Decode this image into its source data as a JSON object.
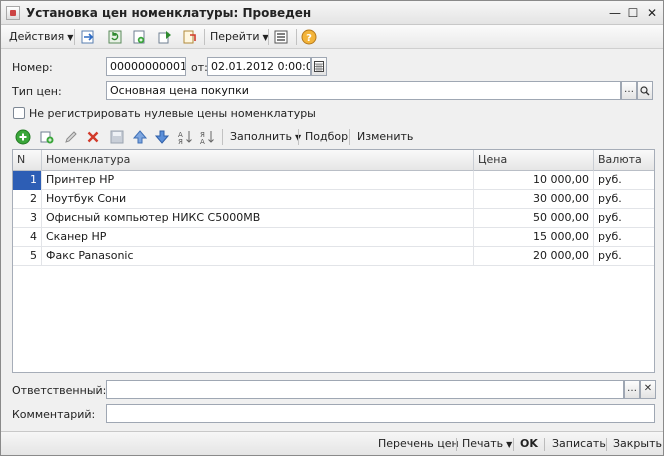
{
  "window": {
    "title": "Установка цен номенклатуры: Проведен",
    "controls": [
      "—",
      "☐",
      "✕"
    ]
  },
  "toolbar": {
    "actions_label": "Действия",
    "goto_label": "Перейти"
  },
  "form": {
    "number_label": "Номер:",
    "number_value": "00000000001",
    "from_label": "от:",
    "date_value": "02.01.2012  0:00:00",
    "price_type_label": "Тип цен:",
    "price_type_value": "Основная цена покупки",
    "checkbox_label": "Не регистрировать нулевые цены номенклатуры"
  },
  "table_toolbar": {
    "fill_label": "Заполнить",
    "select_label": "Подбор",
    "change_label": "Изменить"
  },
  "table": {
    "columns": [
      "N",
      "Номенклатура",
      "Цена",
      "Валюта"
    ],
    "rows": [
      {
        "n": "1",
        "name": "Принтер HP",
        "price": "10 000,00",
        "currency": "руб."
      },
      {
        "n": "2",
        "name": "Ноутбук Сони",
        "price": "30 000,00",
        "currency": "руб."
      },
      {
        "n": "3",
        "name": "Офисный компьютер НИКС С5000МВ",
        "price": "50 000,00",
        "currency": "руб."
      },
      {
        "n": "4",
        "name": "Сканер HP",
        "price": "15 000,00",
        "currency": "руб."
      },
      {
        "n": "5",
        "name": "Факс Panasonic",
        "price": "20 000,00",
        "currency": "руб."
      }
    ]
  },
  "footer_fields": {
    "responsible_label": "Ответственный:",
    "responsible_value": "",
    "comment_label": "Комментарий:",
    "comment_value": ""
  },
  "statusbar": {
    "price_list_label": "Перечень цен",
    "print_label": "Печать",
    "ok_label": "OK",
    "save_label": "Записать",
    "close_label": "Закрыть"
  },
  "colors": {
    "selection": "#2d5eb5",
    "add_icon": "#3aa63a",
    "delete_icon": "#d23a2a",
    "help_icon": "#e5a21e"
  }
}
